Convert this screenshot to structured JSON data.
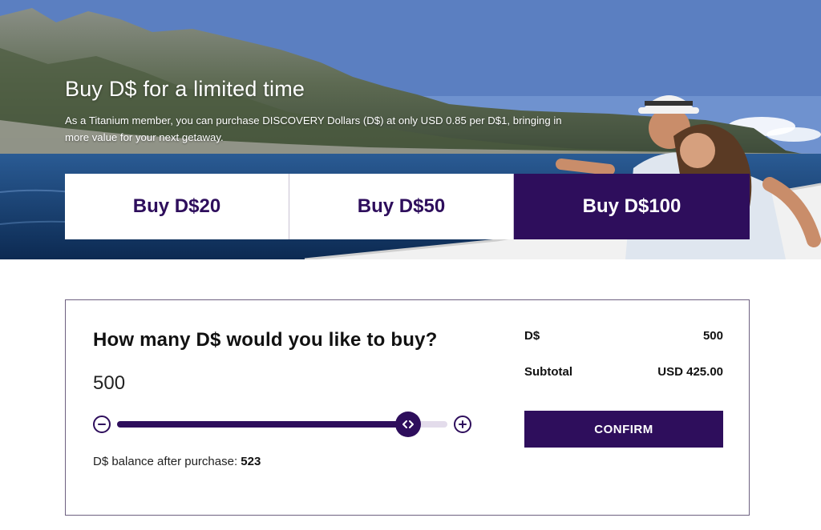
{
  "hero": {
    "title": "Buy D$ for a limited time",
    "description": "As a Titanium member, you can purchase DISCOVERY Dollars (D$) at only USD 0.85 per D$1, bringing in more value for your next getaway."
  },
  "buy_options": [
    {
      "label": "Buy D$20",
      "selected": false
    },
    {
      "label": "Buy D$50",
      "selected": false
    },
    {
      "label": "Buy D$100",
      "selected": true
    }
  ],
  "purchase": {
    "question": "How many D$ would you like to buy?",
    "amount": "500",
    "slider_level": 0.88,
    "balance_label": "D$ balance after purchase:",
    "balance_value": "523"
  },
  "summary": {
    "ds_label": "D$",
    "ds_value": "500",
    "subtotal_label": "Subtotal",
    "subtotal_value": "USD 425.00",
    "confirm_label": "CONFIRM"
  },
  "colors": {
    "brand": "#2e0e5c",
    "card_border": "#6d6080"
  }
}
